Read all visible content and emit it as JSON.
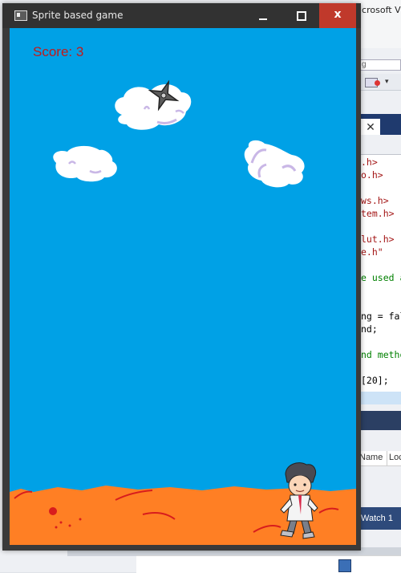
{
  "window": {
    "title": "Sprite based game",
    "controls": {
      "minimize": "minimize",
      "maximize": "maximize",
      "close": "x"
    }
  },
  "game": {
    "score_label": "Score: 3",
    "sky_color": "#00a1e6",
    "ground_color": "#ff7f24",
    "score_color": "#c21a1a",
    "sprites": [
      "cloud",
      "cloud",
      "cloud",
      "shuriken",
      "player-character",
      "ground"
    ]
  },
  "background_ide": {
    "title_fragment": "icrosoft V",
    "tab_close": "✕",
    "code_lines": [
      ".h>",
      "o.h>",
      "",
      "ws.h>",
      "tem.h>",
      "",
      "lut.h>",
      "e.h\"",
      "",
      "e used a",
      "",
      "",
      "ng = fal",
      "nd;",
      "",
      "nd metho",
      "",
      "[20];"
    ],
    "columns": [
      "Name",
      "Loc"
    ],
    "watch_label": "Watch 1"
  }
}
